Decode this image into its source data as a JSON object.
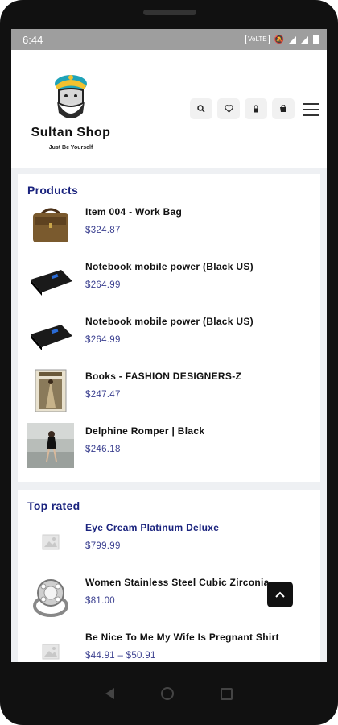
{
  "status": {
    "time": "6:44",
    "volte": "VoLTE"
  },
  "header": {
    "brand": "Sultan Shop",
    "tagline": "Just Be Yourself"
  },
  "products": {
    "title": "Products",
    "items": [
      {
        "name": "Item 004 - Work Bag",
        "price": "$324.87"
      },
      {
        "name": "Notebook mobile power (Black US)",
        "price": "$264.99"
      },
      {
        "name": "Notebook mobile power (Black US)",
        "price": "$264.99"
      },
      {
        "name": "Books - FASHION DESIGNERS-Z",
        "price": "$247.47"
      },
      {
        "name": "Delphine Romper | Black",
        "price": "$246.18"
      }
    ]
  },
  "top_rated": {
    "title": "Top rated",
    "items": [
      {
        "name": "Eye Cream Platinum Deluxe",
        "price": "$799.99"
      },
      {
        "name": "Women Stainless Steel Cubic Zirconia...",
        "price": "$81.00"
      },
      {
        "name": "Be Nice To Me My Wife Is Pregnant Shirt",
        "price": "$44.91 – $50.91"
      }
    ]
  },
  "icons": {
    "search": "search-icon",
    "wishlist": "heart-icon",
    "account": "lock-icon",
    "cart": "cart-icon",
    "menu": "hamburger-icon",
    "to_top": "chevron-up-icon"
  }
}
